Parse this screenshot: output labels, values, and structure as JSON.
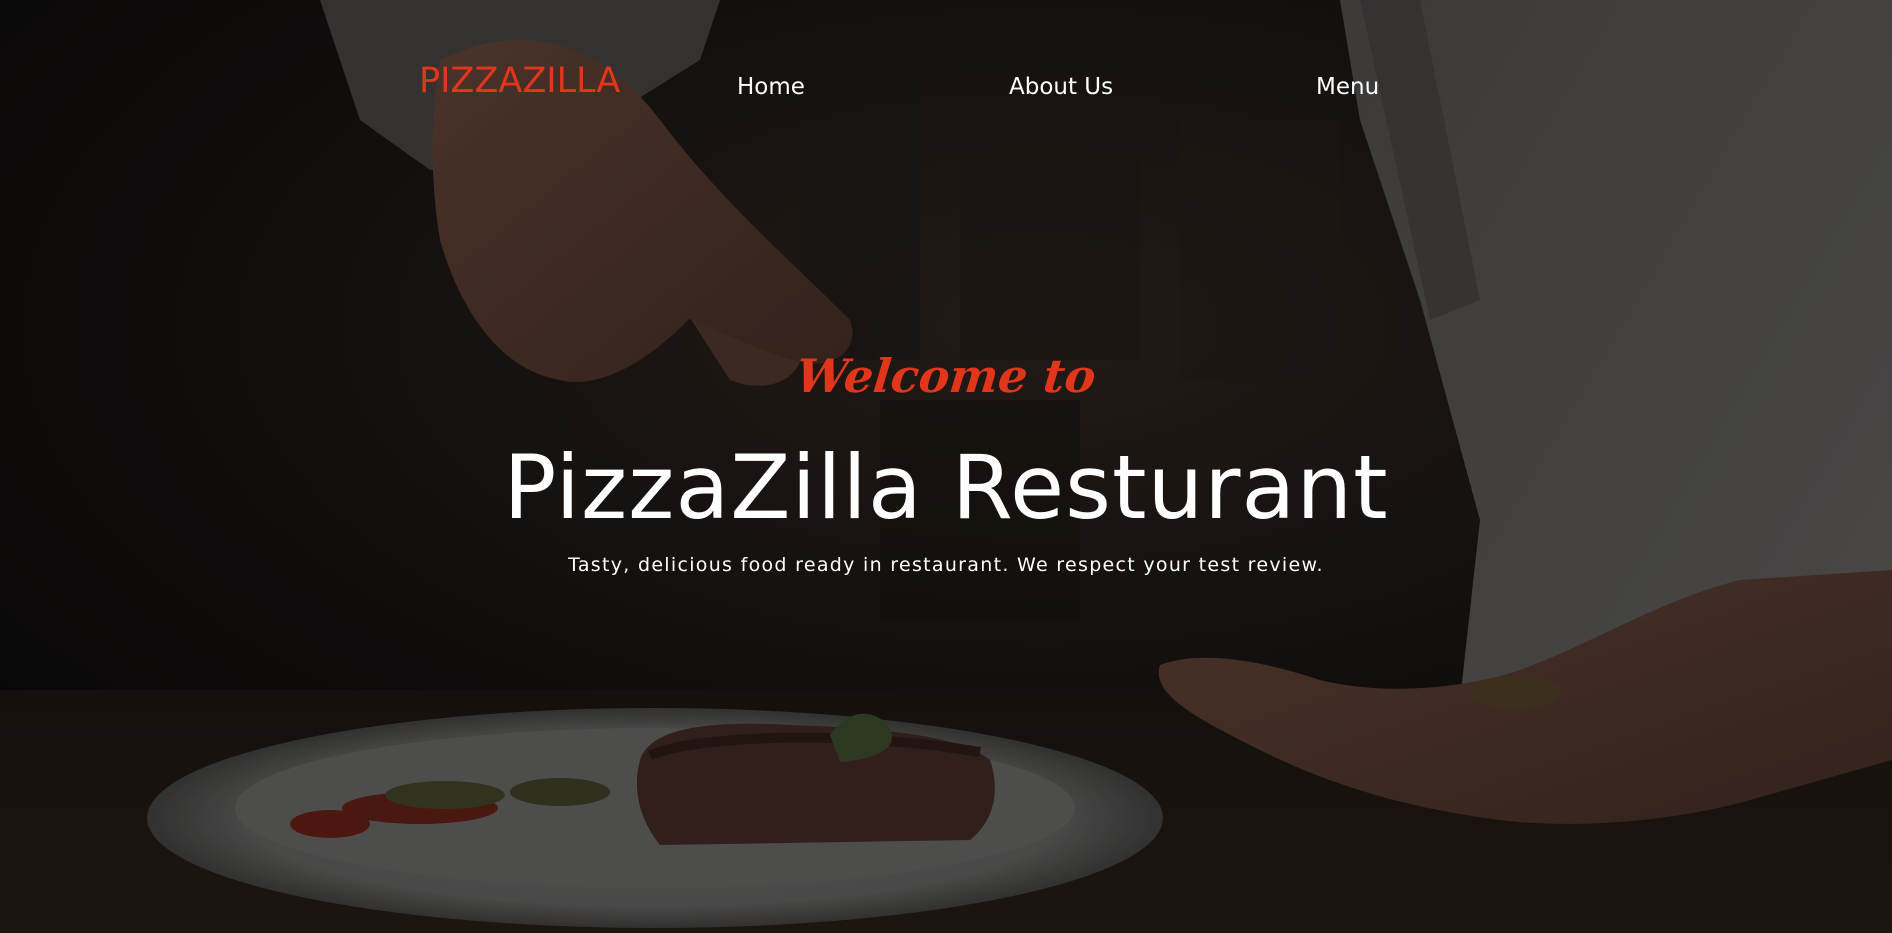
{
  "header": {
    "logo_text": "PIZZAZILLA",
    "nav": [
      {
        "label": "Home"
      },
      {
        "label": "About Us"
      },
      {
        "label": "Menu"
      }
    ]
  },
  "hero": {
    "welcome_text": "Welcome to",
    "title": "PizzaZilla Resturant",
    "subtitle": "Tasty, delicious food ready in restaurant. We respect your test review."
  },
  "colors": {
    "accent": "#e1361c",
    "text": "#ffffff",
    "background": "#0c0b0a"
  }
}
